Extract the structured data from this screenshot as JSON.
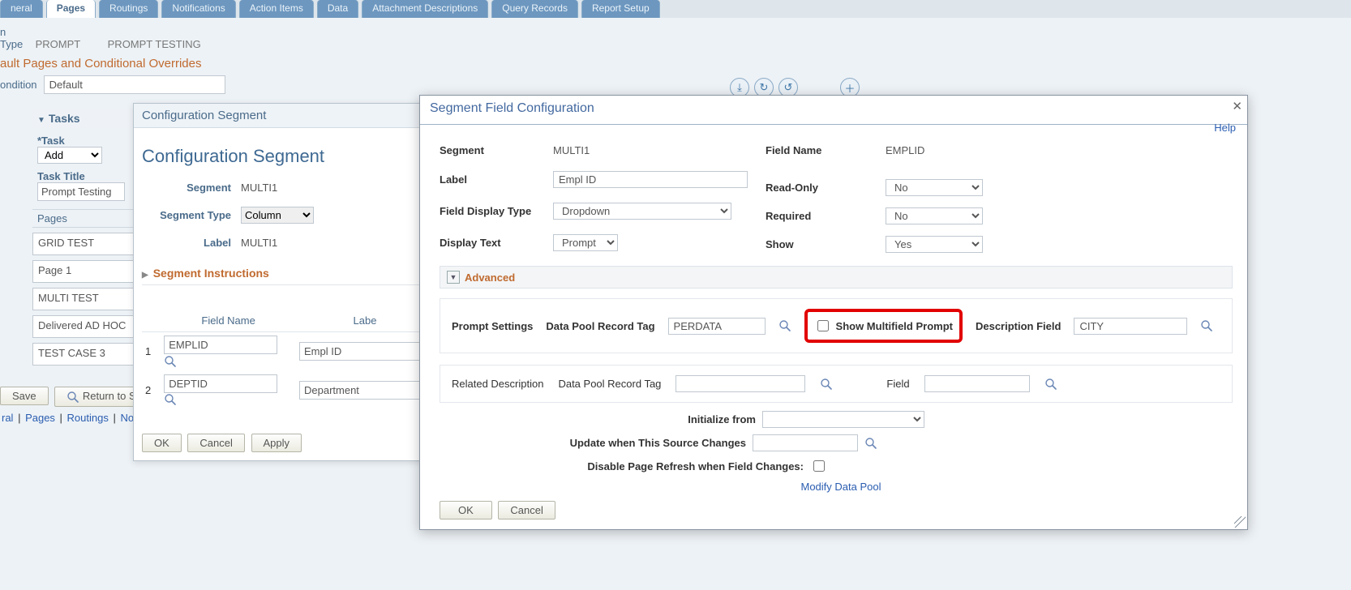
{
  "tabs": {
    "general": "neral",
    "pages": "Pages",
    "routings": "Routings",
    "notifications": "Notifications",
    "action_items": "Action Items",
    "data": "Data",
    "attachment_descriptions": "Attachment Descriptions",
    "query_records": "Query Records",
    "report_setup": "Report Setup"
  },
  "top": {
    "type_label": "n Type",
    "type_value": "PROMPT",
    "title_value": "PROMPT TESTING",
    "section_title": "ault Pages and Conditional Overrides",
    "condition_label": "ondition",
    "condition_value": "Default"
  },
  "tasks": {
    "header": "Tasks",
    "task_label": "*Task",
    "task_dropdown": "Add",
    "task_title_label": "Task Title",
    "task_title_value": "Prompt Testing",
    "pages_header": "Pages",
    "pages": [
      "GRID TEST",
      "Page 1",
      "MULTI TEST",
      "Delivered AD HOC",
      "TEST CASE 3"
    ]
  },
  "bottom": {
    "save": "Save",
    "return": "Return to Search",
    "links": {
      "general": "ral",
      "pages": "Pages",
      "routings": "Routings",
      "notifications": "Notifica"
    }
  },
  "cfgseg": {
    "titlebar": "Configuration Segment",
    "title": "Configuration Segment",
    "segment_label": "Segment",
    "segment_value": "MULTI1",
    "segtype_label": "Segment Type",
    "segtype_value": "Column",
    "label_label": "Label",
    "label_value": "MULTI1",
    "seg_instructions": "Segment Instructions",
    "field_name_hdr": "Field Name",
    "label_hdr": "Labe",
    "rows": [
      {
        "idx": "1",
        "field": "EMPLID",
        "label": "Empl ID"
      },
      {
        "idx": "2",
        "field": "DEPTID",
        "label": "Department"
      }
    ],
    "ok": "OK",
    "cancel": "Cancel",
    "apply": "Apply"
  },
  "modal": {
    "title": "Segment Field Configuration",
    "help": "Help",
    "segment_label": "Segment",
    "segment_value": "MULTI1",
    "label_label": "Label",
    "label_value": "Empl ID",
    "field_display_type_label": "Field Display Type",
    "field_display_type_value": "Dropdown",
    "display_text_label": "Display Text",
    "display_text_value": "Prompt",
    "field_name_label": "Field Name",
    "field_name_value": "EMPLID",
    "readonly_label": "Read-Only",
    "readonly_value": "No",
    "required_label": "Required",
    "required_value": "No",
    "show_label": "Show",
    "show_value": "Yes",
    "advanced": "Advanced",
    "prompt_settings": "Prompt Settings",
    "data_pool_record_tag": "Data Pool Record Tag",
    "data_pool_record_tag_value": "PERDATA",
    "show_multifield_prompt": "Show Multifield Prompt",
    "description_field": "Description Field",
    "description_field_value": "CITY",
    "related_description": "Related Description",
    "data_pool_record_tag2": "Data Pool Record Tag",
    "field_lbl": "Field",
    "initialize_from": "Initialize from",
    "update_when": "Update when This Source Changes",
    "disable_refresh": "Disable Page Refresh when Field Changes:",
    "modify_data_pool": "Modify Data Pool",
    "ok": "OK",
    "cancel": "Cancel"
  }
}
